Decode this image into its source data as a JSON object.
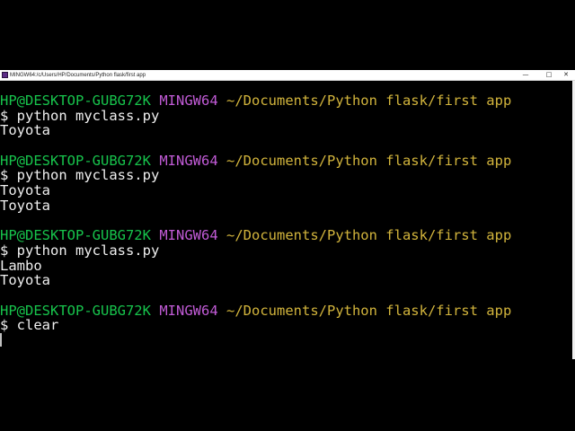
{
  "window": {
    "title": "MINGW64:/c/Users/HP/Documents/Python flask/first app",
    "minimize_glyph": "—",
    "maximize_glyph": "□",
    "close_glyph": "✕"
  },
  "terminal": {
    "blocks": [
      {
        "prompt_user": "HP@DESKTOP-GUBG72K",
        "prompt_env": "MINGW64",
        "prompt_path": "~/Documents/Python flask/first app",
        "command": "$ python myclass.py",
        "output": [
          "Toyota"
        ]
      },
      {
        "prompt_user": "HP@DESKTOP-GUBG72K",
        "prompt_env": "MINGW64",
        "prompt_path": "~/Documents/Python flask/first app",
        "command": "$ python myclass.py",
        "output": [
          "Toyota",
          "Toyota"
        ]
      },
      {
        "prompt_user": "HP@DESKTOP-GUBG72K",
        "prompt_env": "MINGW64",
        "prompt_path": "~/Documents/Python flask/first app",
        "command": "$ python myclass.py",
        "output": [
          "Lambo",
          "Toyota"
        ]
      },
      {
        "prompt_user": "HP@DESKTOP-GUBG72K",
        "prompt_env": "MINGW64",
        "prompt_path": "~/Documents/Python flask/first app",
        "command": "$ clear",
        "output": []
      }
    ]
  },
  "colors": {
    "user": "#17c44c",
    "env": "#c15bd6",
    "path": "#d2b43c",
    "text": "#f0f0f0",
    "background": "#000000"
  }
}
